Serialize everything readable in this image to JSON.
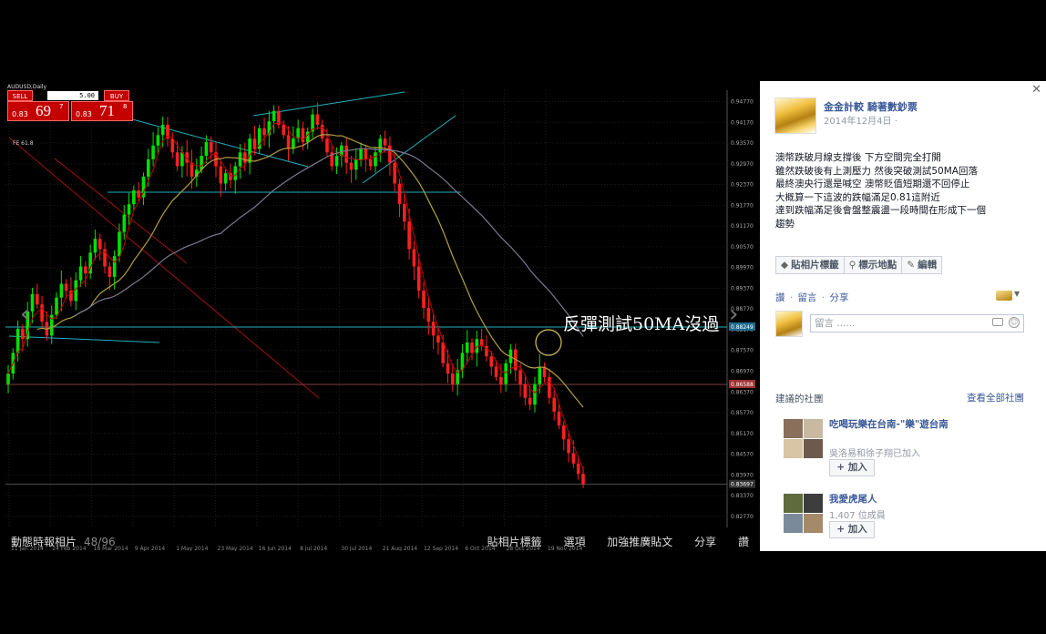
{
  "chart": {
    "symbol": "AUDUSD,Daily",
    "fe_label": "FE 61.8",
    "trade": {
      "sell_label": "SELL",
      "buy_label": "BUY",
      "lot": "5.00",
      "sell_small": "0.83",
      "sell_big": "69",
      "sell_sup": "7",
      "buy_small": "0.83",
      "buy_big": "71",
      "buy_sup": "8"
    },
    "annotation": "反彈測試50MA沒過",
    "price_ticks": [
      "0.94770",
      "0.94170",
      "0.93570",
      "0.92970",
      "0.92370",
      "0.91770",
      "0.91170",
      "0.90570",
      "0.89970",
      "0.89370",
      "0.88770",
      "0.88170",
      "0.87570",
      "0.86970",
      "0.86370",
      "0.85770",
      "0.85170",
      "0.84570",
      "0.83970",
      "0.83370",
      "0.82770"
    ],
    "price_markers": {
      "upper": "0.88249",
      "middle": "0.86588",
      "current": "0.83697"
    },
    "date_ticks": [
      "11 Jan 2014",
      "24 Feb 2014",
      "18 Mar 2014",
      "9 Apr 2014",
      "1 May 2014",
      "23 May 2014",
      "16 Jun 2014",
      "8 Jul 2014",
      "30 Jul 2014",
      "21 Aug 2014",
      "12 Sep 2014",
      "6 Oct 2014",
      "28 Oct 2014",
      "19 Nov 2014"
    ],
    "colors": {
      "bull": "#00e000",
      "bear": "#ff2020",
      "ma_fast": "#c00000",
      "ma_mid": "#b0a040",
      "ma_slow": "#7a7a90",
      "trendline": "#22b0c0",
      "diag": "#a01010"
    },
    "series_closes": [
      0.869,
      0.875,
      0.882,
      0.879,
      0.887,
      0.892,
      0.889,
      0.884,
      0.88,
      0.886,
      0.891,
      0.895,
      0.893,
      0.89,
      0.896,
      0.9,
      0.898,
      0.904,
      0.908,
      0.905,
      0.9,
      0.897,
      0.903,
      0.91,
      0.915,
      0.918,
      0.922,
      0.92,
      0.926,
      0.931,
      0.935,
      0.938,
      0.941,
      0.937,
      0.933,
      0.929,
      0.933,
      0.93,
      0.926,
      0.928,
      0.932,
      0.936,
      0.933,
      0.929,
      0.924,
      0.927,
      0.925,
      0.929,
      0.933,
      0.93,
      0.937,
      0.934,
      0.94,
      0.938,
      0.942,
      0.945,
      0.941,
      0.938,
      0.934,
      0.937,
      0.94,
      0.936,
      0.939,
      0.944,
      0.941,
      0.937,
      0.933,
      0.929,
      0.932,
      0.935,
      0.93,
      0.928,
      0.931,
      0.934,
      0.931,
      0.929,
      0.933,
      0.937,
      0.935,
      0.93,
      0.924,
      0.918,
      0.913,
      0.905,
      0.9,
      0.893,
      0.888,
      0.884,
      0.88,
      0.878,
      0.872,
      0.869,
      0.866,
      0.87,
      0.875,
      0.878,
      0.875,
      0.879,
      0.877,
      0.874,
      0.871,
      0.868,
      0.866,
      0.872,
      0.876,
      0.87,
      0.866,
      0.862,
      0.86,
      0.866,
      0.871,
      0.868,
      0.862,
      0.858,
      0.854,
      0.85,
      0.846,
      0.843,
      0.84,
      0.837
    ]
  },
  "viewer_bar": {
    "album": "動態時報相片",
    "count": "48/96",
    "actions": [
      "貼相片標籤",
      "選項",
      "加強推廣貼文",
      "分享",
      "讚"
    ]
  },
  "post": {
    "page_name": "金金計較 騎著數鈔票",
    "date": "2014年12月4日 ·",
    "lines": [
      "澳幣跌破月線支撐後 下方空間完全打開",
      "雖然跌破後有上測壓力 然後突破測試50MA回落",
      "最終澳央行還是喊空 澳幣貶值短期還不回停止",
      "大概算一下這波的跌幅滿足0.81這附近",
      "達到跌幅滿足後會盤整震盪一段時間在形成下一個",
      "趨勢"
    ],
    "tag_buttons": [
      "貼相片標籤",
      "標示地點",
      "編輯"
    ],
    "actions": [
      "讚",
      "留言",
      "分享"
    ],
    "comment_placeholder": "留言 ......"
  },
  "suggested": {
    "title": "建議的社團",
    "see_all": "查看全部社團",
    "groups": [
      {
        "name": "吃喝玩樂在台南-\"樂\"遊台南",
        "sub": "吳洛易和徐子翔已加入",
        "join": "+ 加入"
      },
      {
        "name": "我愛虎尾人",
        "sub": "1,407 位成員",
        "join": "+ 加入"
      }
    ]
  }
}
